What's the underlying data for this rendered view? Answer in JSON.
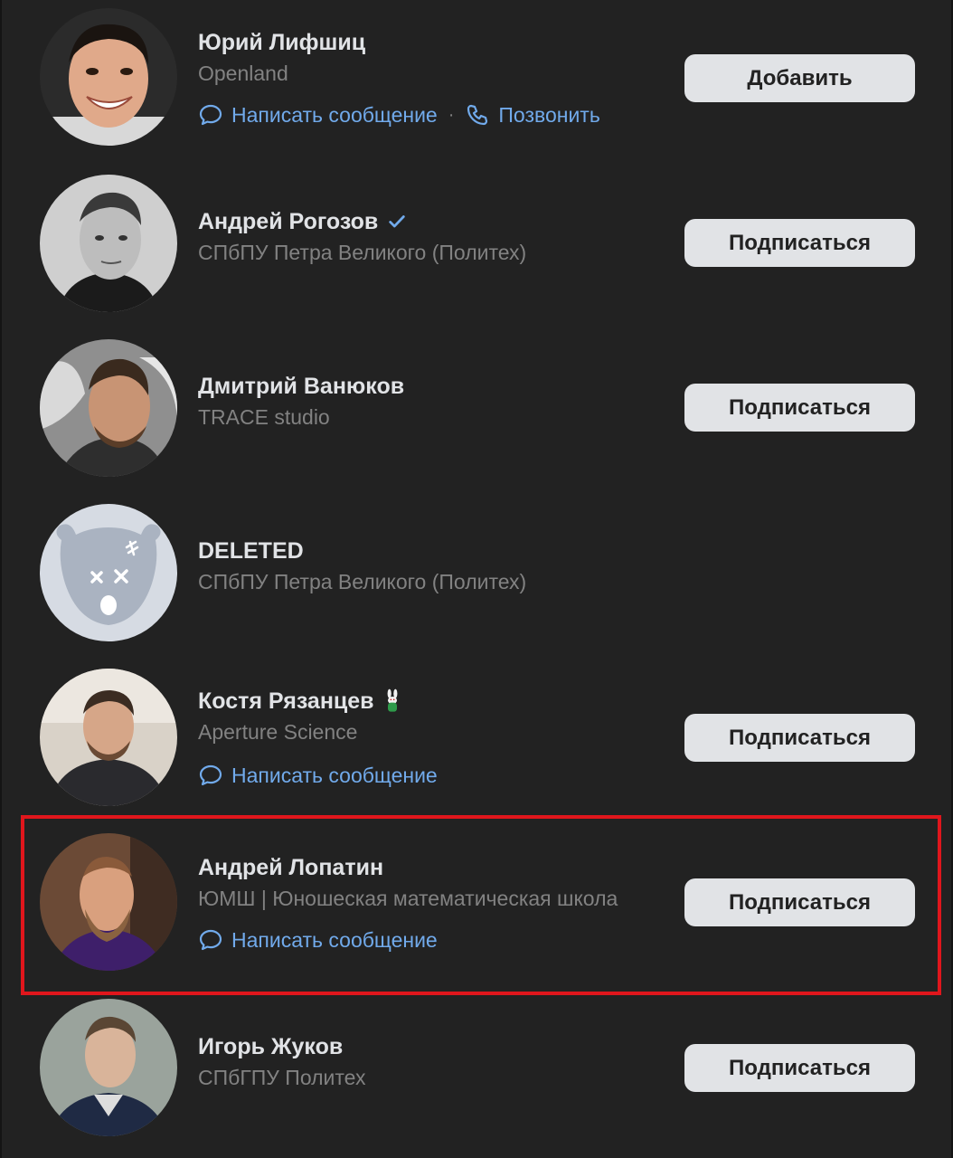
{
  "people": [
    {
      "name": "Юрий Лифшиц",
      "subtitle": "Openland",
      "action_message": "Написать сообщение",
      "action_call": "Позвонить",
      "button": "Добавить"
    },
    {
      "name": "Андрей Рогозов",
      "verified": true,
      "subtitle": "СПбПУ Петра Великого (Политех)",
      "button": "Подписаться"
    },
    {
      "name": "Дмитрий Ванюков",
      "subtitle": "TRACE studio",
      "button": "Подписаться"
    },
    {
      "name": "DELETED",
      "subtitle": "СПбПУ Петра Великого (Политех)"
    },
    {
      "name": "Костя Рязанцев",
      "emoji": "🐰",
      "subtitle": "Aperture Science",
      "action_message": "Написать сообщение",
      "button": "Подписаться"
    },
    {
      "name": "Андрей Лопатин",
      "subtitle": "ЮМШ | Юношеская математическая школа",
      "action_message": "Написать сообщение",
      "button": "Подписаться",
      "highlighted": true
    },
    {
      "name": "Игорь Жуков",
      "subtitle": "СПбГПУ Политех",
      "button": "Подписаться"
    }
  ],
  "colors": {
    "background": "#222222",
    "name": "#e1e3e6",
    "subtitle": "#828282",
    "link": "#71aaeb",
    "button_bg": "#e1e3e6",
    "verified": "#71aaeb",
    "highlight": "#e0161c"
  },
  "icons": {
    "message": "speech-bubble-icon",
    "call": "phone-icon",
    "verified": "checkmark-icon"
  }
}
